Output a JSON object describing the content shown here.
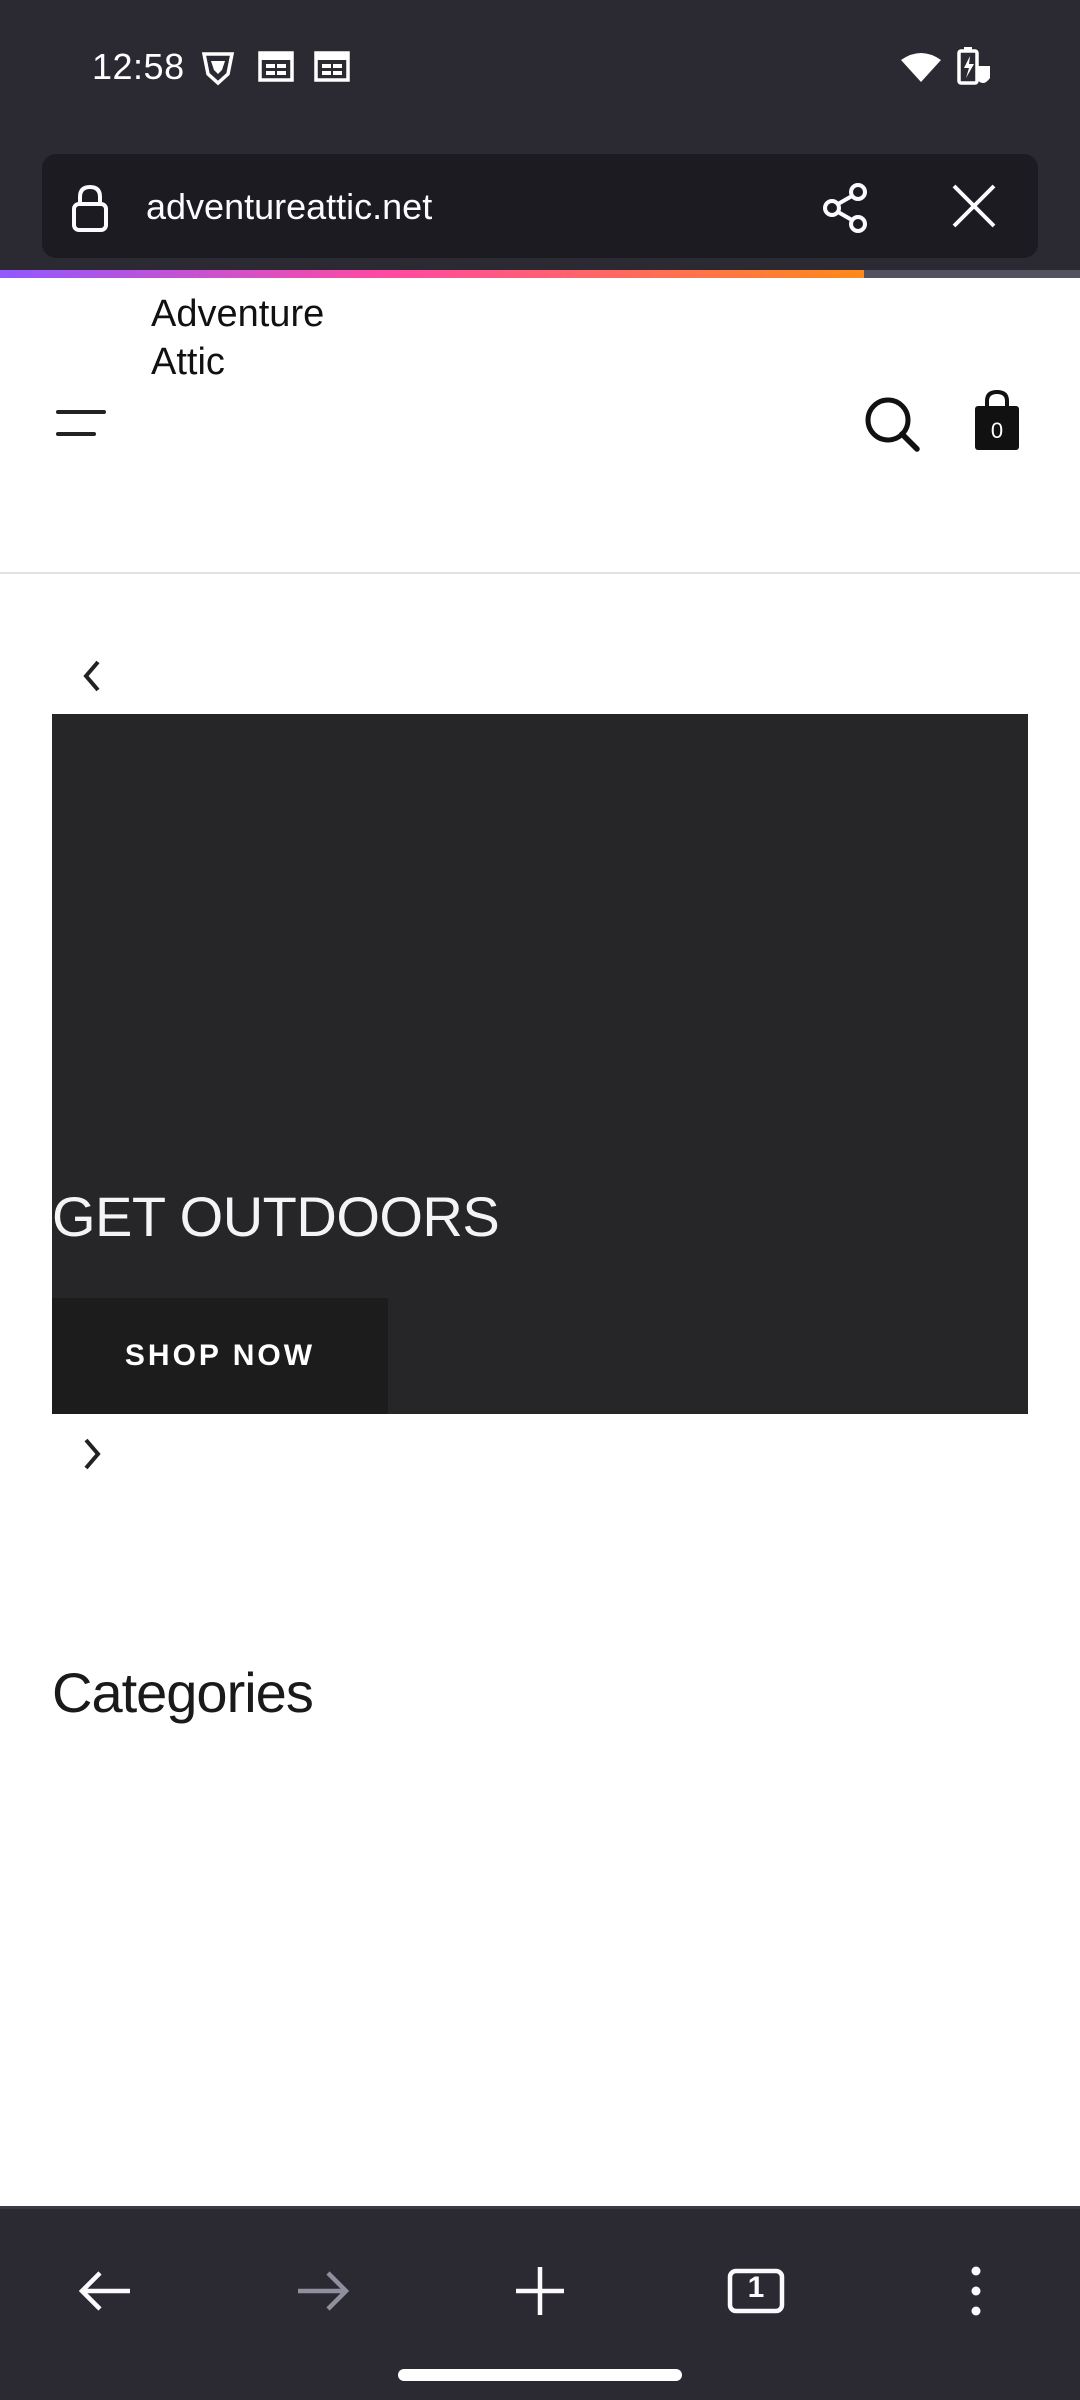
{
  "status_bar": {
    "time": "12:58"
  },
  "browser": {
    "url": "adventureattic.net",
    "load_progress": 0.8
  },
  "site": {
    "logo_line1": "Adventure",
    "logo_line2": "Attic",
    "cart_count": "0"
  },
  "hero": {
    "title": "GET OUTDOORS",
    "button_label": "SHOP NOW"
  },
  "sections": {
    "categories_title": "Categories"
  },
  "bottom_nav": {
    "tab_count": "1"
  },
  "colors": {
    "chrome_bg": "#2b2a33",
    "url_field_bg": "#1c1b22",
    "hero_bg": "#262628"
  }
}
